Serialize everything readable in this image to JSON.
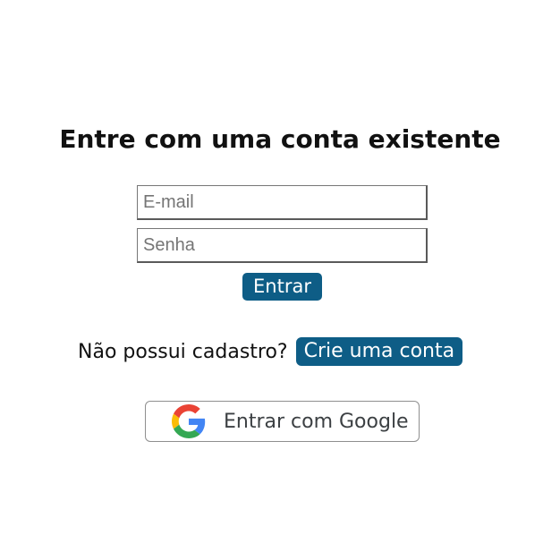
{
  "login": {
    "title": "Entre com uma conta existente",
    "email_placeholder": "E-mail",
    "email_value": "",
    "password_placeholder": "Senha",
    "password_value": "",
    "submit_label": "Entrar"
  },
  "signup": {
    "prompt": "Não possui cadastro?",
    "link_label": "Crie uma conta"
  },
  "google": {
    "label": "Entrar com Google",
    "icon": "google-g-logo"
  },
  "colors": {
    "accent": "#0e5d86",
    "google_blue": "#4285F4",
    "google_red": "#EA4335",
    "google_yellow": "#FBBC05",
    "google_green": "#34A853"
  }
}
